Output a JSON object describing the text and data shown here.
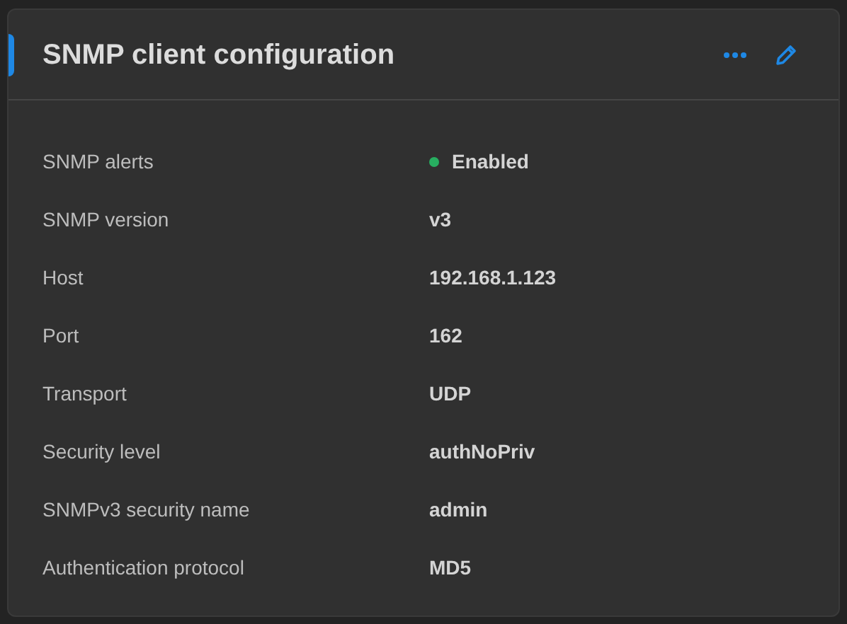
{
  "card": {
    "title": "SNMP client configuration"
  },
  "rows": [
    {
      "kind": "status",
      "label": "SNMP alerts",
      "value": "Enabled",
      "color": "#27ae60"
    },
    {
      "kind": "text",
      "label": "SNMP version",
      "value": "v3"
    },
    {
      "kind": "text",
      "label": "Host",
      "value": "192.168.1.123"
    },
    {
      "kind": "text",
      "label": "Port",
      "value": "162"
    },
    {
      "kind": "text",
      "label": "Transport",
      "value": "UDP"
    },
    {
      "kind": "text",
      "label": "Security level",
      "value": "authNoPriv"
    },
    {
      "kind": "text",
      "label": "SNMPv3 security name",
      "value": "admin"
    },
    {
      "kind": "text",
      "label": "Authentication protocol",
      "value": "MD5"
    }
  ]
}
